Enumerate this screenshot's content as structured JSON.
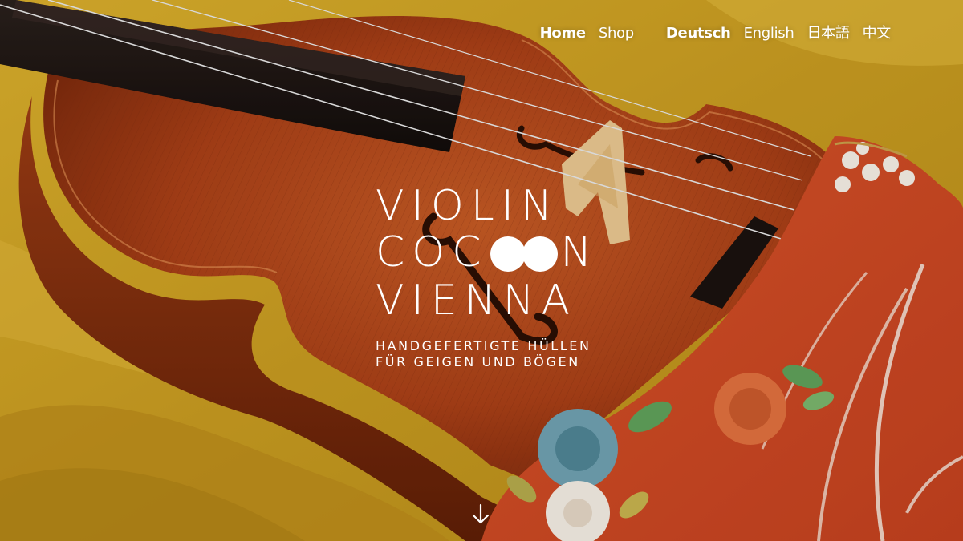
{
  "nav": {
    "home": "Home",
    "shop": "Shop",
    "lang_de": "Deutsch",
    "lang_en": "English",
    "lang_ja": "日本語",
    "lang_zh": "中文"
  },
  "logo": {
    "line1": "VIOLIN",
    "line2_prefix": "COC",
    "line2_suffix": "N",
    "line3": "VIENNA",
    "tagline1": "HANDGEFERTIGTE HÜLLEN",
    "tagline2": "FÜR GEIGEN UND BÖGEN"
  },
  "scroll_icon": "arrow-down-icon",
  "colors": {
    "silk_yellow": "#c9a024",
    "violin_wood": "#a8401a",
    "kimono_red": "#d9542a",
    "text": "#ffffff"
  }
}
